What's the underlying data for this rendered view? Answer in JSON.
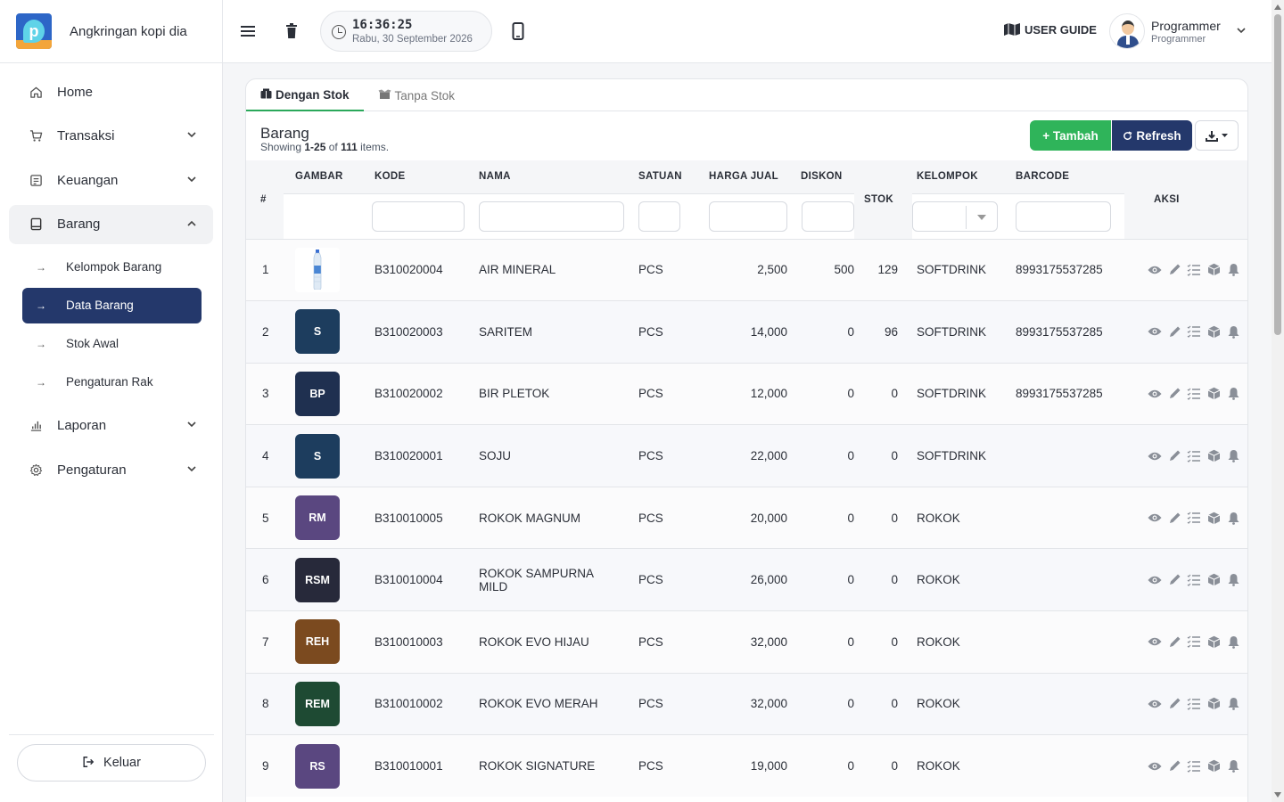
{
  "app": {
    "name": "Angkringan kopi dia"
  },
  "sidebar": {
    "items": [
      {
        "label": "Home",
        "icon": "home-icon"
      },
      {
        "label": "Transaksi",
        "icon": "cart-icon"
      },
      {
        "label": "Keuangan",
        "icon": "ledger-icon"
      },
      {
        "label": "Barang",
        "icon": "box-icon"
      },
      {
        "label": "Laporan",
        "icon": "bar-chart-icon"
      },
      {
        "label": "Pengaturan",
        "icon": "gear-icon"
      }
    ],
    "barang_sub": [
      {
        "label": "Kelompok Barang"
      },
      {
        "label": "Data Barang"
      },
      {
        "label": "Stok Awal"
      },
      {
        "label": "Pengaturan Rak"
      }
    ],
    "logout_label": "Keluar"
  },
  "topbar": {
    "time": "16:36:25",
    "date": "Rabu, 30 September 2026",
    "guide_label": "USER GUIDE",
    "user_name": "Programmer",
    "user_role": "Programmer"
  },
  "tabs": [
    {
      "label": "Dengan Stok"
    },
    {
      "label": "Tanpa Stok"
    }
  ],
  "card": {
    "title": "Barang",
    "showing_prefix": "Showing ",
    "showing_range": "1-25",
    "showing_of": " of ",
    "showing_total": "111",
    "showing_suffix": " items.",
    "add_label": "+ Tambah",
    "refresh_label": "Refresh"
  },
  "table": {
    "headers": {
      "no": "#",
      "gambar": "GAMBAR",
      "kode": "KODE",
      "nama": "NAMA",
      "satuan": "SATUAN",
      "harga": "HARGA JUAL",
      "diskon": "DISKON",
      "stok": "STOK",
      "kelompok": "KELOMPOK",
      "barcode": "BARCODE",
      "aksi": "AKSI"
    },
    "rows": [
      {
        "no": "1",
        "initials": "",
        "color": "#ffffff",
        "kode": "B310020004",
        "nama": "AIR MINERAL",
        "satuan": "PCS",
        "harga": "2,500",
        "diskon": "500",
        "stok": "129",
        "kelompok": "SOFTDRINK",
        "barcode": "8993175537285"
      },
      {
        "no": "2",
        "initials": "S",
        "color": "#1d3d5e",
        "kode": "B310020003",
        "nama": "SARITEM",
        "satuan": "PCS",
        "harga": "14,000",
        "diskon": "0",
        "stok": "96",
        "kelompok": "SOFTDRINK",
        "barcode": "8993175537285"
      },
      {
        "no": "3",
        "initials": "BP",
        "color": "#1f3050",
        "kode": "B310020002",
        "nama": "BIR PLETOK",
        "satuan": "PCS",
        "harga": "12,000",
        "diskon": "0",
        "stok": "0",
        "kelompok": "SOFTDRINK",
        "barcode": "8993175537285"
      },
      {
        "no": "4",
        "initials": "S",
        "color": "#1d3d5e",
        "kode": "B310020001",
        "nama": "SOJU",
        "satuan": "PCS",
        "harga": "22,000",
        "diskon": "0",
        "stok": "0",
        "kelompok": "SOFTDRINK",
        "barcode": ""
      },
      {
        "no": "5",
        "initials": "RM",
        "color": "#5a4780",
        "kode": "B310010005",
        "nama": "ROKOK MAGNUM",
        "satuan": "PCS",
        "harga": "20,000",
        "diskon": "0",
        "stok": "0",
        "kelompok": "ROKOK",
        "barcode": ""
      },
      {
        "no": "6",
        "initials": "RSM",
        "color": "#27293a",
        "kode": "B310010004",
        "nama": "ROKOK SAMPURNA MILD",
        "satuan": "PCS",
        "harga": "26,000",
        "diskon": "0",
        "stok": "0",
        "kelompok": "ROKOK",
        "barcode": ""
      },
      {
        "no": "7",
        "initials": "REH",
        "color": "#7b4a1f",
        "kode": "B310010003",
        "nama": "ROKOK EVO HIJAU",
        "satuan": "PCS",
        "harga": "32,000",
        "diskon": "0",
        "stok": "0",
        "kelompok": "ROKOK",
        "barcode": ""
      },
      {
        "no": "8",
        "initials": "REM",
        "color": "#1e4a33",
        "kode": "B310010002",
        "nama": "ROKOK EVO MERAH",
        "satuan": "PCS",
        "harga": "32,000",
        "diskon": "0",
        "stok": "0",
        "kelompok": "ROKOK",
        "barcode": ""
      },
      {
        "no": "9",
        "initials": "RS",
        "color": "#5a4780",
        "kode": "B310010001",
        "nama": "ROKOK SIGNATURE",
        "satuan": "PCS",
        "harga": "19,000",
        "diskon": "0",
        "stok": "0",
        "kelompok": "ROKOK",
        "barcode": ""
      }
    ]
  },
  "colors": {
    "primary": "#24386b",
    "success": "#2fb45a",
    "tab_active": "#2aa85a"
  }
}
